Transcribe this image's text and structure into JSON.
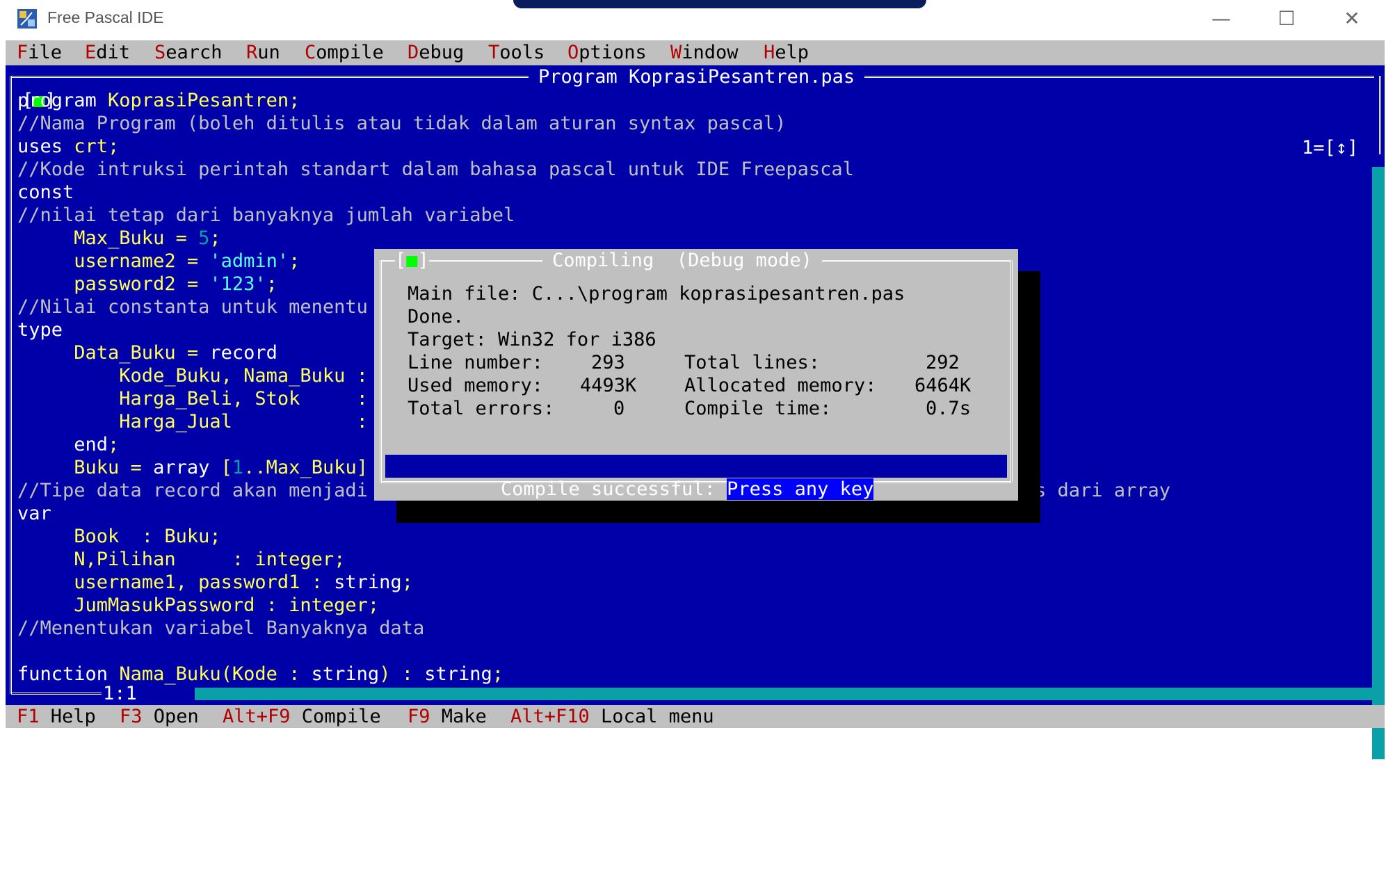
{
  "window": {
    "title": "Free Pascal IDE",
    "minimize": "—",
    "maximize": "☐",
    "close": "✕"
  },
  "menu": [
    {
      "hot": "F",
      "rest": "ile"
    },
    {
      "hot": "E",
      "rest": "dit"
    },
    {
      "hot": "S",
      "rest": "earch"
    },
    {
      "hot": "R",
      "rest": "un"
    },
    {
      "hot": "C",
      "rest": "ompile"
    },
    {
      "hot": "D",
      "rest": "ebug"
    },
    {
      "hot": "T",
      "rest": "ools"
    },
    {
      "hot": "O",
      "rest": "ptions"
    },
    {
      "hot": "W",
      "rest": "indow"
    },
    {
      "hot": "H",
      "rest": "elp"
    }
  ],
  "editor": {
    "title": "Program KoprasiPesantren.pas",
    "close_box": "[■]",
    "window_number": "1=[↕]",
    "cursor_position": "1:1",
    "lines": [
      [
        {
          "c": "k",
          "t": "program "
        },
        {
          "c": "y",
          "t": "KoprasiPesantren;"
        }
      ],
      [
        {
          "c": "cmt",
          "t": "//Nama Program (boleh ditulis atau tidak dalam aturan syntax pascal)"
        }
      ],
      [
        {
          "c": "k",
          "t": "uses "
        },
        {
          "c": "y",
          "t": "crt;"
        }
      ],
      [
        {
          "c": "cmt",
          "t": "//Kode intruksi perintah standart dalam bahasa pascal untuk IDE Freepascal"
        }
      ],
      [
        {
          "c": "k",
          "t": "const"
        }
      ],
      [
        {
          "c": "cmt",
          "t": "//nilai tetap dari banyaknya jumlah variabel"
        }
      ],
      [
        {
          "c": "y",
          "t": "     Max_Buku = "
        },
        {
          "c": "num",
          "t": "5"
        },
        {
          "c": "y",
          "t": ";"
        }
      ],
      [
        {
          "c": "y",
          "t": "     username2 = "
        },
        {
          "c": "str",
          "t": "'admin'"
        },
        {
          "c": "y",
          "t": ";"
        }
      ],
      [
        {
          "c": "y",
          "t": "     password2 = "
        },
        {
          "c": "str",
          "t": "'123'"
        },
        {
          "c": "y",
          "t": ";"
        }
      ],
      [
        {
          "c": "cmt",
          "t": "//Nilai constanta untuk menentu"
        }
      ],
      [
        {
          "c": "k",
          "t": "type"
        }
      ],
      [
        {
          "c": "y",
          "t": "     Data_Buku = "
        },
        {
          "c": "k",
          "t": "record"
        }
      ],
      [
        {
          "c": "y",
          "t": "         Kode_Buku, Nama_Buku :"
        }
      ],
      [
        {
          "c": "y",
          "t": "         Harga_Beli, Stok     :"
        }
      ],
      [
        {
          "c": "y",
          "t": "         Harga_Jual           :"
        }
      ],
      [
        {
          "c": "k",
          "t": "     end"
        },
        {
          "c": "y",
          "t": ";"
        }
      ],
      [
        {
          "c": "y",
          "t": "     Buku = "
        },
        {
          "c": "k",
          "t": "array "
        },
        {
          "c": "y",
          "t": "["
        },
        {
          "c": "num",
          "t": "1"
        },
        {
          "c": "y",
          "t": "..Max_Buku]"
        }
      ],
      [
        {
          "c": "cmt",
          "t": "//Tipe data record akan menjadi                                                       basis dari array"
        }
      ],
      [
        {
          "c": "k",
          "t": "var"
        }
      ],
      [
        {
          "c": "y",
          "t": "     Book  : Buku;"
        }
      ],
      [
        {
          "c": "y",
          "t": "     N,Pilihan     : integer;"
        }
      ],
      [
        {
          "c": "y",
          "t": "     username1, password1 : "
        },
        {
          "c": "k",
          "t": "string"
        },
        {
          "c": "y",
          "t": ";"
        }
      ],
      [
        {
          "c": "y",
          "t": "     JumMasukPassword : integer;"
        }
      ],
      [
        {
          "c": "cmt",
          "t": "//Menentukan variabel Banyaknya data"
        }
      ],
      [
        {
          "c": "k",
          "t": ""
        }
      ],
      [
        {
          "c": "k",
          "t": "function "
        },
        {
          "c": "y",
          "t": "Nama_Buku(Kode : "
        },
        {
          "c": "k",
          "t": "string"
        },
        {
          "c": "y",
          "t": ") : "
        },
        {
          "c": "k",
          "t": "string"
        },
        {
          "c": "y",
          "t": ";"
        }
      ]
    ]
  },
  "dialog": {
    "close_box_open": "[",
    "close_box_mark": "■",
    "close_box_close": "]",
    "title": "Compiling  (Debug mode)",
    "main_file": "Main file: C...\\program koprasipesantren.pas",
    "done": "Done.",
    "target": "Target: Win32 for i386",
    "line_number_label": "Line number:",
    "line_number_value": "293",
    "total_lines_label": "Total lines:",
    "total_lines_value": "292",
    "used_memory_label": "Used memory:",
    "used_memory_value": "4493K",
    "allocated_memory_label": "Allocated memory:",
    "allocated_memory_value": "6464K",
    "total_errors_label": "Total errors:",
    "total_errors_value": "0",
    "compile_time_label": "Compile time:",
    "compile_time_value": "0.7s",
    "status_text": "Compile successful: ",
    "status_highlight": "Press any key"
  },
  "statusbar": [
    {
      "hot": "F1",
      "rest": " Help"
    },
    {
      "hot": "F3",
      "rest": " Open"
    },
    {
      "hot": "Alt+F9",
      "rest": " Compile"
    },
    {
      "hot": "F9",
      "rest": " Make"
    },
    {
      "hot": "Alt+F10",
      "rest": " Local menu"
    }
  ],
  "colors": {
    "editor_bg": "#0000a8",
    "menu_bg": "#c0c0c0",
    "hotkey": "#b00000",
    "keyword": "#ffffff",
    "identifier": "#ffff55",
    "string": "#55ffff",
    "comment": "#c0c0c0"
  }
}
